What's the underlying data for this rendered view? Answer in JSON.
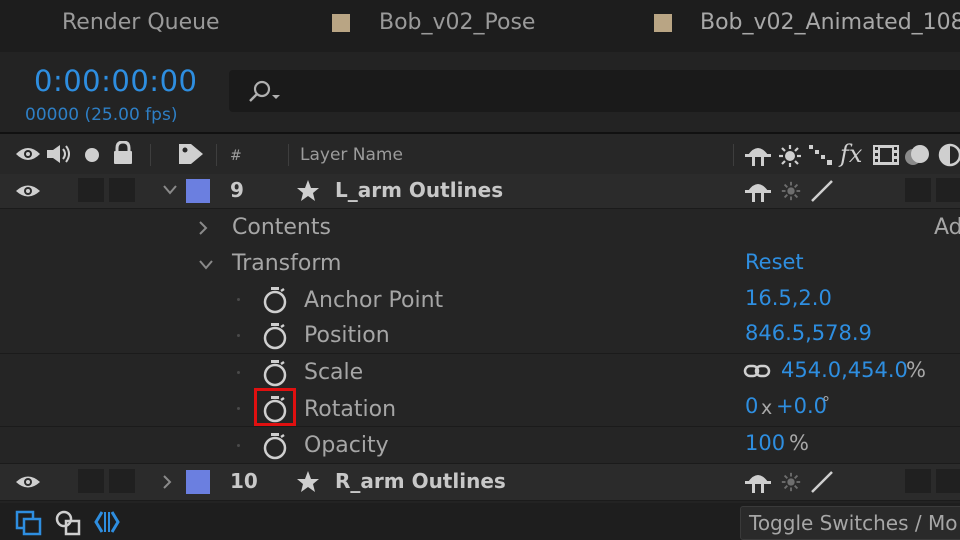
{
  "tabs": [
    {
      "label": "Render Queue"
    },
    {
      "label": "Bob_v02_Pose",
      "swatch_color": "#b9a584"
    },
    {
      "label": "Bob_v02_Animated_108",
      "swatch_color": "#b9a584"
    }
  ],
  "timeline": {
    "timecode": "0:00:00:00",
    "frame_info": "00000 (25.00 fps)",
    "search_placeholder": ""
  },
  "columns": {
    "number": "#",
    "layer_name": "Layer Name"
  },
  "layers": [
    {
      "number": "9",
      "name": "L_arm Outlines",
      "label_color": "#6b7fe0",
      "expanded": true
    },
    {
      "number": "10",
      "name": "R_arm Outlines",
      "label_color": "#6b7fe0",
      "expanded": false
    }
  ],
  "contents": {
    "label": "Contents",
    "add_label": "Ad"
  },
  "transform": {
    "label": "Transform",
    "reset_label": "Reset",
    "properties": {
      "anchor_point": {
        "name": "Anchor Point",
        "value": "16.5,2.0"
      },
      "position": {
        "name": "Position",
        "value": "846.5,578.9"
      },
      "scale": {
        "name": "Scale",
        "value": "454.0,454.0",
        "unit": "%"
      },
      "rotation": {
        "name": "Rotation",
        "turns": "0",
        "turns_unit": "x",
        "degrees": "+0.0",
        "degrees_unit": "°"
      },
      "opacity": {
        "name": "Opacity",
        "value": "100",
        "unit": "%"
      }
    }
  },
  "bottom": {
    "toggle_label": "Toggle Switches / Mo"
  },
  "colors": {
    "accent": "#2e8ee0",
    "highlight": "#e01010"
  }
}
